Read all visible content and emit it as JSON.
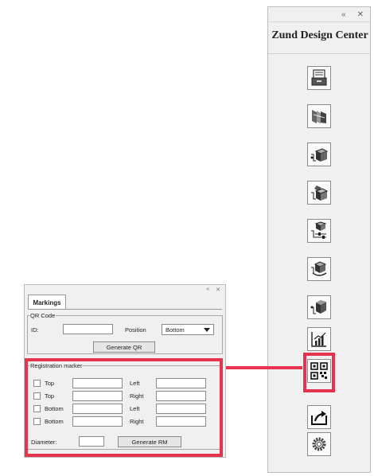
{
  "toolbar_panel": {
    "title": "Zund Design Center",
    "collapse_glyph": "«",
    "close_glyph": "✕",
    "tools": [
      {
        "icon": "document-tray-icon"
      },
      {
        "icon": "layered-sheets-icon"
      },
      {
        "icon": "box-add-icon"
      },
      {
        "icon": "box-fold-icon"
      },
      {
        "icon": "cube-settings-icon"
      },
      {
        "icon": "box-rotate-icon"
      },
      {
        "icon": "box-flap-icon"
      },
      {
        "icon": "bar-chart-icon"
      },
      {
        "icon": "qr-code-icon",
        "selected": true
      },
      {
        "icon": "export-icon"
      },
      {
        "icon": "gear-icon"
      }
    ]
  },
  "markings_panel": {
    "collapse_glyph": "«",
    "close_glyph": "✕",
    "tab": "Markings",
    "qr_code": {
      "legend": "QR Code",
      "id_label": "ID:",
      "id_value": "",
      "position_label": "Position",
      "position_value": "Bottom",
      "generate_label": "Generate QR"
    },
    "registration_marker": {
      "legend": "Registration marker",
      "rows": [
        {
          "label": "Top",
          "side": "Left"
        },
        {
          "label": "Top",
          "side": "Right"
        },
        {
          "label": "Bottom",
          "side": "Left"
        },
        {
          "label": "Bottom",
          "side": "Right"
        }
      ],
      "diameter_label": "Diameter:",
      "diameter_value": "",
      "generate_label": "Generate RM"
    }
  },
  "colors": {
    "highlight": "#e6334f",
    "panel_bg": "#f0f0f0"
  }
}
